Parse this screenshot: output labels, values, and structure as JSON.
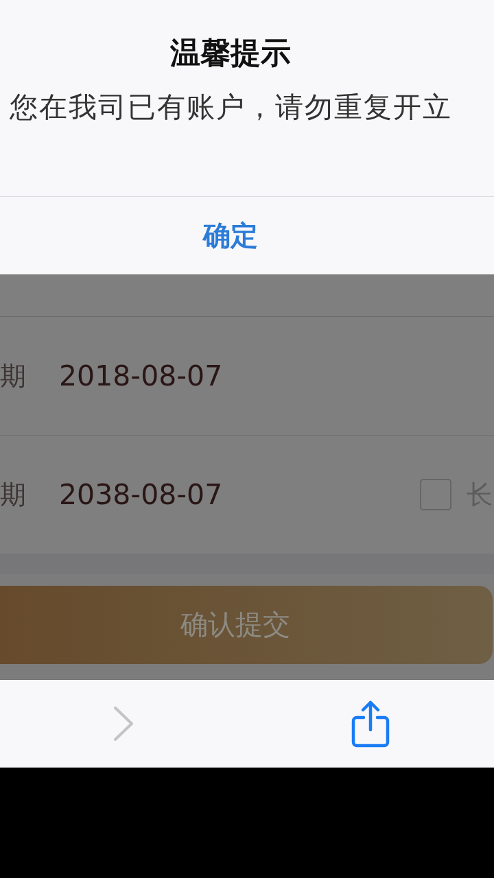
{
  "dialog": {
    "title": "温馨提示",
    "message": "您在我司已有账户，请勿重复开立",
    "button": "确定"
  },
  "form": {
    "rows": [
      {
        "label": "期",
        "value": "2018-08-07"
      },
      {
        "label": "期",
        "value": "2038-08-07",
        "checkbox": {
          "checked": false,
          "label": "长"
        }
      }
    ],
    "submit": {
      "label": "确认提交",
      "disabled": true
    }
  },
  "toolbar": {
    "forward": {
      "disabled": true
    }
  }
}
